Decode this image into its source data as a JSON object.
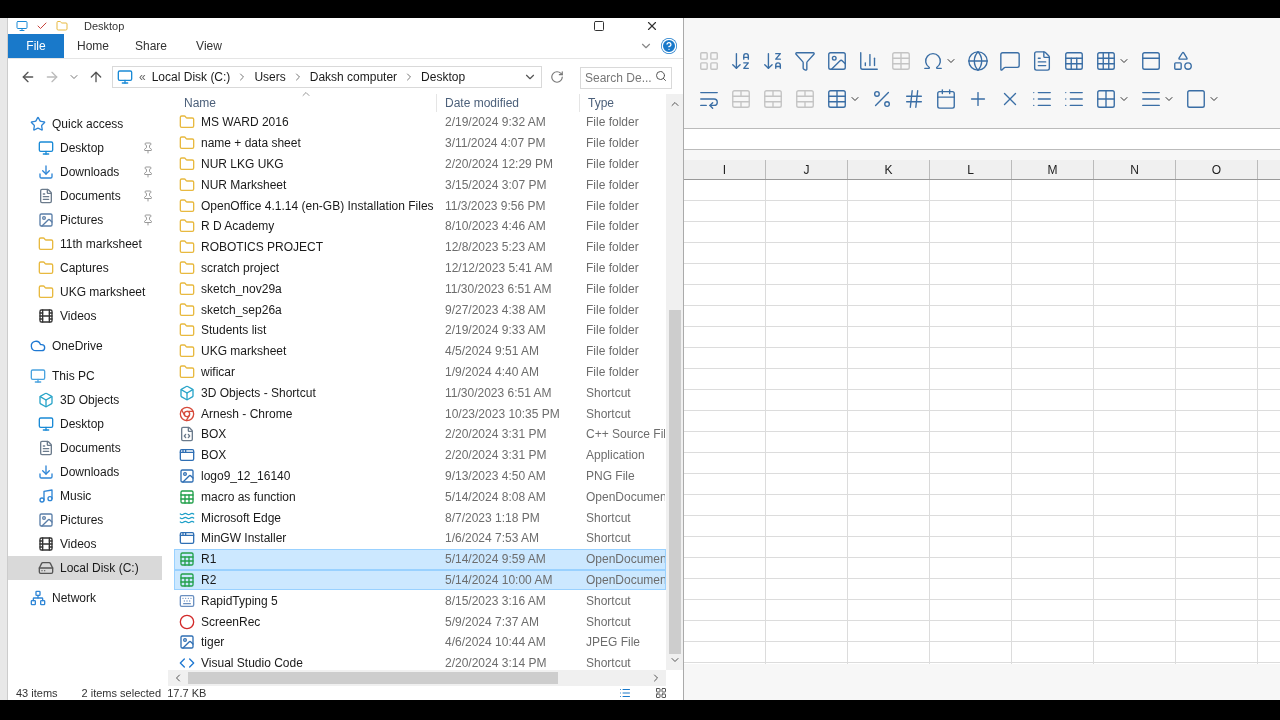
{
  "explorer": {
    "title": "Desktop",
    "ribbon_tabs": [
      {
        "label": "File",
        "selected": true
      },
      {
        "label": "Home",
        "selected": false
      },
      {
        "label": "Share",
        "selected": false
      },
      {
        "label": "View",
        "selected": false
      }
    ],
    "breadcrumb": [
      "Local Disk (C:)",
      "Users",
      "Daksh computer",
      "Desktop"
    ],
    "breadcrumb_overflow": "«",
    "search": {
      "placeholder": "Search De..."
    },
    "nav": [
      {
        "label": "Quick access",
        "kind": "star",
        "selected": false,
        "children": [
          {
            "label": "Desktop",
            "kind": "desktop",
            "pinned": true,
            "selected": false
          },
          {
            "label": "Downloads",
            "kind": "download",
            "pinned": true,
            "selected": false
          },
          {
            "label": "Documents",
            "kind": "document",
            "pinned": true,
            "selected": false
          },
          {
            "label": "Pictures",
            "kind": "pictures",
            "pinned": true,
            "selected": false
          },
          {
            "label": "11th marksheet",
            "kind": "folder",
            "pinned": false,
            "selected": false
          },
          {
            "label": "Captures",
            "kind": "folder",
            "pinned": false,
            "selected": false
          },
          {
            "label": "UKG marksheet",
            "kind": "folder",
            "pinned": false,
            "selected": false
          },
          {
            "label": "Videos",
            "kind": "videos",
            "pinned": false,
            "selected": false
          }
        ]
      },
      {
        "label": "OneDrive",
        "kind": "cloud",
        "selected": false
      },
      {
        "label": "This PC",
        "kind": "pc",
        "selected": false,
        "children": [
          {
            "label": "3D Objects",
            "kind": "cube",
            "pinned": false,
            "selected": false
          },
          {
            "label": "Desktop",
            "kind": "desktop",
            "pinned": false,
            "selected": false
          },
          {
            "label": "Documents",
            "kind": "document",
            "pinned": false,
            "selected": false
          },
          {
            "label": "Downloads",
            "kind": "download",
            "pinned": false,
            "selected": false
          },
          {
            "label": "Music",
            "kind": "music",
            "pinned": false,
            "selected": false
          },
          {
            "label": "Pictures",
            "kind": "pictures",
            "pinned": false,
            "selected": false
          },
          {
            "label": "Videos",
            "kind": "videos",
            "pinned": false,
            "selected": false
          },
          {
            "label": "Local Disk (C:)",
            "kind": "disk",
            "pinned": false,
            "selected": true
          }
        ]
      },
      {
        "label": "Network",
        "kind": "network",
        "selected": false
      }
    ],
    "columns": [
      "Name",
      "Date modified",
      "Type"
    ],
    "rows": [
      {
        "name": "MS WARD 2016",
        "date": "2/19/2024 9:32 AM",
        "type": "File folder",
        "kind": "folder",
        "selected": false
      },
      {
        "name": "name + data sheet",
        "date": "3/11/2024 4:07 PM",
        "type": "File folder",
        "kind": "folder",
        "selected": false
      },
      {
        "name": "NUR LKG UKG",
        "date": "2/20/2024 12:29 PM",
        "type": "File folder",
        "kind": "folder",
        "selected": false
      },
      {
        "name": "NUR Marksheet",
        "date": "3/15/2024 3:07 PM",
        "type": "File folder",
        "kind": "folder",
        "selected": false
      },
      {
        "name": "OpenOffice 4.1.14 (en-GB) Installation Files",
        "date": "11/3/2023 9:56 PM",
        "type": "File folder",
        "kind": "folder",
        "selected": false
      },
      {
        "name": "R D Academy",
        "date": "8/10/2023 4:46 AM",
        "type": "File folder",
        "kind": "folder",
        "selected": false
      },
      {
        "name": "ROBOTICS PROJECT",
        "date": "12/8/2023 5:23 AM",
        "type": "File folder",
        "kind": "folder",
        "selected": false
      },
      {
        "name": "scratch project",
        "date": "12/12/2023 5:41 AM",
        "type": "File folder",
        "kind": "folder",
        "selected": false
      },
      {
        "name": "sketch_nov29a",
        "date": "11/30/2023 6:51 AM",
        "type": "File folder",
        "kind": "folder",
        "selected": false
      },
      {
        "name": "sketch_sep26a",
        "date": "9/27/2023 4:38 AM",
        "type": "File folder",
        "kind": "folder",
        "selected": false
      },
      {
        "name": "Students list",
        "date": "2/19/2024 9:33 AM",
        "type": "File folder",
        "kind": "folder",
        "selected": false
      },
      {
        "name": "UKG marksheet",
        "date": "4/5/2024 9:51 AM",
        "type": "File folder",
        "kind": "folder",
        "selected": false
      },
      {
        "name": "wificar",
        "date": "1/9/2024 4:40 AM",
        "type": "File folder",
        "kind": "folder",
        "selected": false
      },
      {
        "name": "3D Objects - Shortcut",
        "date": "11/30/2023 6:51 AM",
        "type": "Shortcut",
        "kind": "cube",
        "selected": false
      },
      {
        "name": "Arnesh - Chrome",
        "date": "10/23/2023 10:35 PM",
        "type": "Shortcut",
        "kind": "browser",
        "selected": false
      },
      {
        "name": "BOX",
        "date": "2/20/2024 3:31 PM",
        "type": "C++ Source Fil",
        "kind": "source",
        "selected": false
      },
      {
        "name": "BOX",
        "date": "2/20/2024 3:31 PM",
        "type": "Application",
        "kind": "app",
        "selected": false
      },
      {
        "name": "logo9_12_16140",
        "date": "9/13/2023 4:50 AM",
        "type": "PNG File",
        "kind": "image",
        "selected": false
      },
      {
        "name": "macro as function",
        "date": "5/14/2024 8:08 AM",
        "type": "OpenDocumen",
        "kind": "sheet",
        "selected": false
      },
      {
        "name": "Microsoft Edge",
        "date": "8/7/2023 1:18 PM",
        "type": "Shortcut",
        "kind": "wave",
        "selected": false
      },
      {
        "name": "MinGW Installer",
        "date": "1/6/2024 7:53 AM",
        "type": "Shortcut",
        "kind": "app",
        "selected": false
      },
      {
        "name": "R1",
        "date": "5/14/2024 9:59 AM",
        "type": "OpenDocumen",
        "kind": "sheet",
        "selected": true
      },
      {
        "name": "R2",
        "date": "5/14/2024 10:00 AM",
        "type": "OpenDocumen",
        "kind": "sheet",
        "selected": true
      },
      {
        "name": "RapidTyping 5",
        "date": "8/15/2023 3:16 AM",
        "type": "Shortcut",
        "kind": "keyboard",
        "selected": false
      },
      {
        "name": "ScreenRec",
        "date": "5/9/2024 7:37 AM",
        "type": "Shortcut",
        "kind": "record",
        "selected": false
      },
      {
        "name": "tiger",
        "date": "4/6/2024 10:44 AM",
        "type": "JPEG File",
        "kind": "image",
        "selected": false
      },
      {
        "name": "Visual Studio Code",
        "date": "2/20/2024 3:14 PM",
        "type": "Shortcut",
        "kind": "code",
        "selected": false
      }
    ],
    "status": [
      "43 items",
      "2 items selected  17.7 KB"
    ]
  },
  "spreadsheet": {
    "toolbar_rows": [
      [
        {
          "kind": "sort",
          "disabled": true
        },
        {
          "kind": "sort-asc",
          "disabled": false
        },
        {
          "kind": "sort-desc",
          "disabled": false
        },
        {
          "kind": "filter",
          "disabled": false
        },
        {
          "kind": "image",
          "disabled": false
        },
        {
          "kind": "chart",
          "disabled": false
        },
        {
          "kind": "pivot",
          "disabled": true
        },
        {
          "kind": "omega",
          "disabled": false
        },
        {
          "kind": "dropdown",
          "disabled": false
        },
        {
          "kind": "link",
          "disabled": false
        },
        {
          "kind": "comment",
          "disabled": false
        },
        {
          "kind": "page",
          "disabled": false
        },
        {
          "kind": "table",
          "disabled": false
        },
        {
          "kind": "grid",
          "disabled": false
        },
        {
          "kind": "dropdown",
          "disabled": false
        },
        {
          "kind": "panel",
          "disabled": false
        },
        {
          "kind": "shapes",
          "disabled": false
        }
      ],
      [
        {
          "kind": "wrap",
          "disabled": false
        },
        {
          "kind": "merge",
          "disabled": true
        },
        {
          "kind": "merge",
          "disabled": true
        },
        {
          "kind": "merge",
          "disabled": true
        },
        {
          "kind": "condition",
          "disabled": false
        },
        {
          "kind": "dropdown",
          "disabled": false
        },
        {
          "kind": "percent",
          "disabled": false
        },
        {
          "kind": "number",
          "disabled": false
        },
        {
          "kind": "calendar",
          "disabled": false
        },
        {
          "kind": "add-decimal",
          "disabled": false
        },
        {
          "kind": "del-decimal",
          "disabled": false
        },
        {
          "kind": "indent-more",
          "disabled": false
        },
        {
          "kind": "indent-less",
          "disabled": false
        },
        {
          "kind": "borders",
          "disabled": false
        },
        {
          "kind": "dropdown",
          "disabled": false
        },
        {
          "kind": "border-style",
          "disabled": false
        },
        {
          "kind": "dropdown",
          "disabled": false
        },
        {
          "kind": "border-color",
          "disabled": false
        },
        {
          "kind": "dropdown",
          "disabled": false
        }
      ]
    ],
    "columns": [
      "I",
      "J",
      "K",
      "L",
      "M",
      "N",
      "O"
    ]
  }
}
